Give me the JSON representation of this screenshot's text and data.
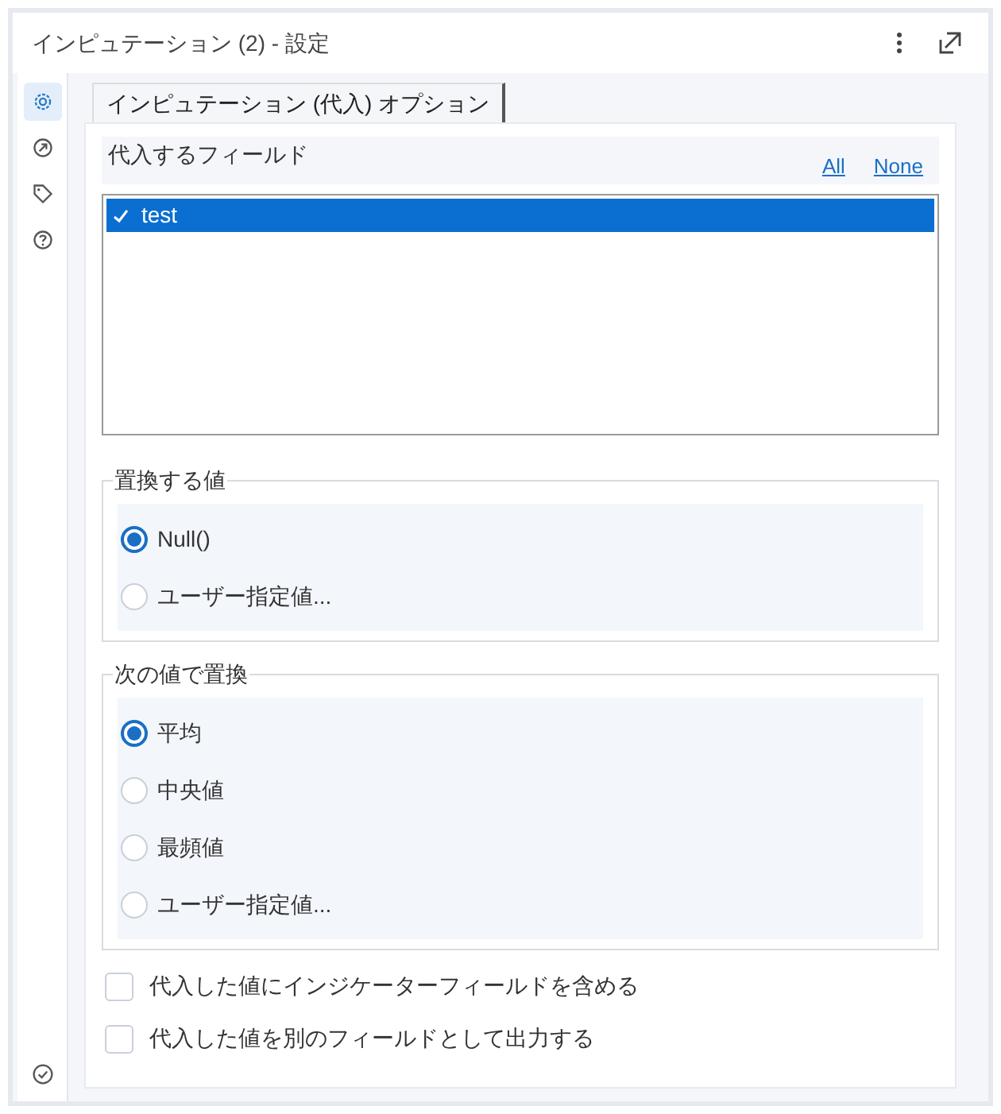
{
  "window": {
    "title": "インピュテーション (2) - 設定"
  },
  "sidebar": {
    "items": [
      {
        "kind": "settings",
        "selected": true
      },
      {
        "kind": "connection",
        "selected": false
      },
      {
        "kind": "tag",
        "selected": false
      },
      {
        "kind": "help",
        "selected": false
      }
    ]
  },
  "tabs": [
    {
      "label": "インピュテーション (代入) オプション",
      "selected": true
    }
  ],
  "fields": {
    "title": "代入するフィールド",
    "links": [
      "All",
      "None"
    ],
    "items": [
      {
        "label": "test",
        "checked": true,
        "selected": true
      }
    ]
  },
  "groups": [
    {
      "title": "置換する値",
      "options": [
        {
          "label": "Null()",
          "selected": true
        },
        {
          "label": "ユーザー指定値...",
          "selected": false
        }
      ]
    },
    {
      "title": "次の値で置換",
      "options": [
        {
          "label": "平均",
          "selected": true
        },
        {
          "label": "中央値",
          "selected": false
        },
        {
          "label": "最頻値",
          "selected": false
        },
        {
          "label": "ユーザー指定値...",
          "selected": false
        }
      ]
    }
  ],
  "checkboxes": [
    {
      "label": "代入した値にインジケーターフィールドを含める",
      "checked": false
    },
    {
      "label": "代入した値を別のフィールドとして出力する",
      "checked": false
    }
  ]
}
